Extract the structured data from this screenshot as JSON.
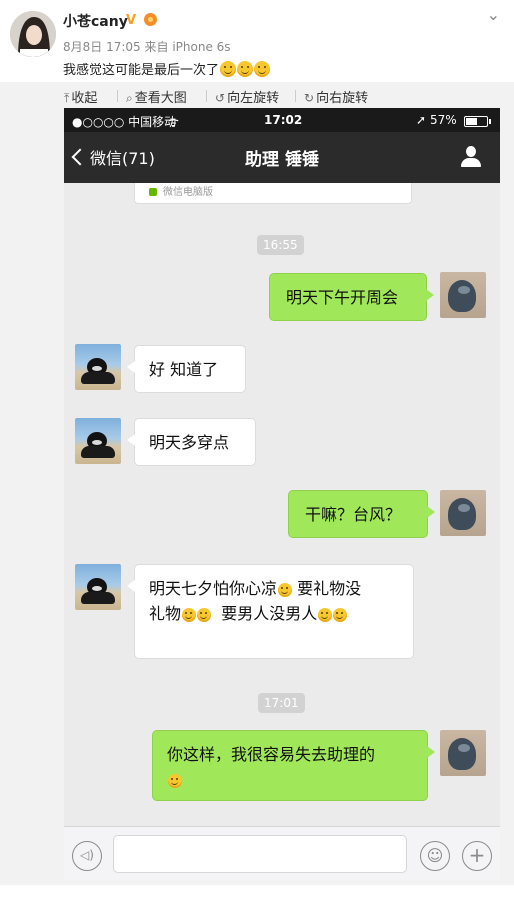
{
  "weibo": {
    "username": "小苍cany",
    "verified_badge": "V",
    "date": "8月8日 17:05",
    "source": "来自 iPhone 6s",
    "post_text": "我感觉这可能是最后一次了",
    "post_emojis": [
      "smile-emoji",
      "smile-emoji",
      "smile-emoji"
    ],
    "dropdown_icon": "chevron-down-icon"
  },
  "toolbar": {
    "collapse": "收起",
    "view_large": "查看大图",
    "rotate_left": "向左旋转",
    "rotate_right": "向右旋转"
  },
  "phone": {
    "status": {
      "carrier": "●○○○○ 中国移动",
      "time": "17:02",
      "battery": "57%",
      "battery_level": 0.57
    },
    "nav": {
      "back_label": "微信(71)",
      "title": "助理 锤锤"
    },
    "prev_card_text": "微信电脑版",
    "messages": [
      {
        "type": "time",
        "text": "16:55"
      },
      {
        "type": "out",
        "text": "明天下午开周会"
      },
      {
        "type": "in",
        "text": "好 知道了"
      },
      {
        "type": "in",
        "text": "明天多穿点"
      },
      {
        "type": "out",
        "text": "干嘛？台风？"
      },
      {
        "type": "in",
        "text_parts": [
          "明天七夕怕你心凉",
          "要礼物没",
          "礼物",
          "要男人没男人"
        ]
      },
      {
        "type": "time",
        "text": "17:01"
      },
      {
        "type": "out",
        "text": "你这样，我很容易失去助理的"
      }
    ]
  },
  "colors": {
    "outgoing_bubble": "#a0e75a",
    "incoming_bubble": "#ffffff",
    "nav_bg": "#2b2b2b",
    "chat_bg": "#ebebeb",
    "verified": "#f7a21a"
  }
}
